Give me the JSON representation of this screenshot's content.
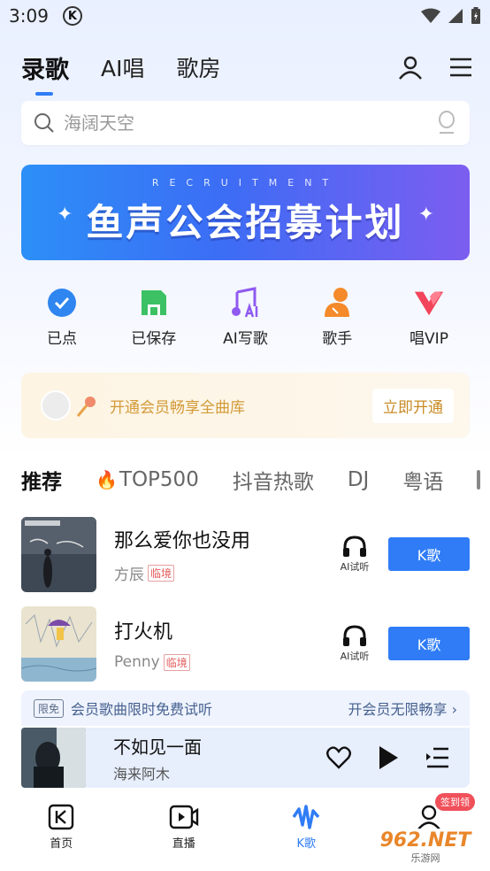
{
  "status_bar": {
    "time": "3:09",
    "app_indicator": "K"
  },
  "top_nav": {
    "tabs": [
      "录歌",
      "AI唱",
      "歌房"
    ],
    "active_tab": "录歌",
    "icons": [
      "user-icon",
      "menu-icon"
    ]
  },
  "search": {
    "placeholder": "海阔天空",
    "icons": [
      "search-icon",
      "mic-icon"
    ]
  },
  "banner": {
    "subtitle": "RECRUITMENT",
    "title": "鱼声公会招募计划"
  },
  "quick_actions": [
    {
      "label": "已点",
      "icon": "check-icon"
    },
    {
      "label": "已保存",
      "icon": "save-icon"
    },
    {
      "label": "AI写歌",
      "icon": "ai-note-icon"
    },
    {
      "label": "歌手",
      "icon": "singer-icon"
    },
    {
      "label": "唱VIP",
      "icon": "vip-icon"
    }
  ],
  "vip_bar": {
    "text": "开通会员畅享全曲库",
    "button": "立即开通"
  },
  "category_tabs": {
    "items": [
      "推荐",
      "TOP500",
      "抖音热歌",
      "DJ",
      "粤语"
    ],
    "active": "推荐",
    "fire_on": "TOP500"
  },
  "songs": [
    {
      "title": "那么爱你也没用",
      "artist": "方辰",
      "tag": "临境",
      "ai_label": "AI试听",
      "action": "K歌"
    },
    {
      "title": "打火机",
      "artist": "Penny",
      "tag": "临境",
      "ai_label": "AI试听",
      "action": "K歌"
    }
  ],
  "free_bar": {
    "badge": "限免",
    "message": "会员歌曲限时免费试听",
    "link": "开会员无限畅享"
  },
  "now_playing": {
    "title": "不如见一面",
    "artist": "海来阿木"
  },
  "bottom_nav": {
    "items": [
      {
        "label": "首页",
        "icon": "k-home-icon"
      },
      {
        "label": "直播",
        "icon": "live-icon"
      },
      {
        "label": "K歌",
        "icon": "k-song-wave-icon",
        "active": true
      },
      {
        "label": "",
        "icon": "profile-icon"
      }
    ],
    "badge": "签到领"
  },
  "watermark": {
    "main": "962.NET",
    "sub": "乐游网"
  },
  "colors": {
    "accent": "#2f7cf6",
    "vip_text": "#d39b3a",
    "tag_red": "#e35b5b"
  }
}
